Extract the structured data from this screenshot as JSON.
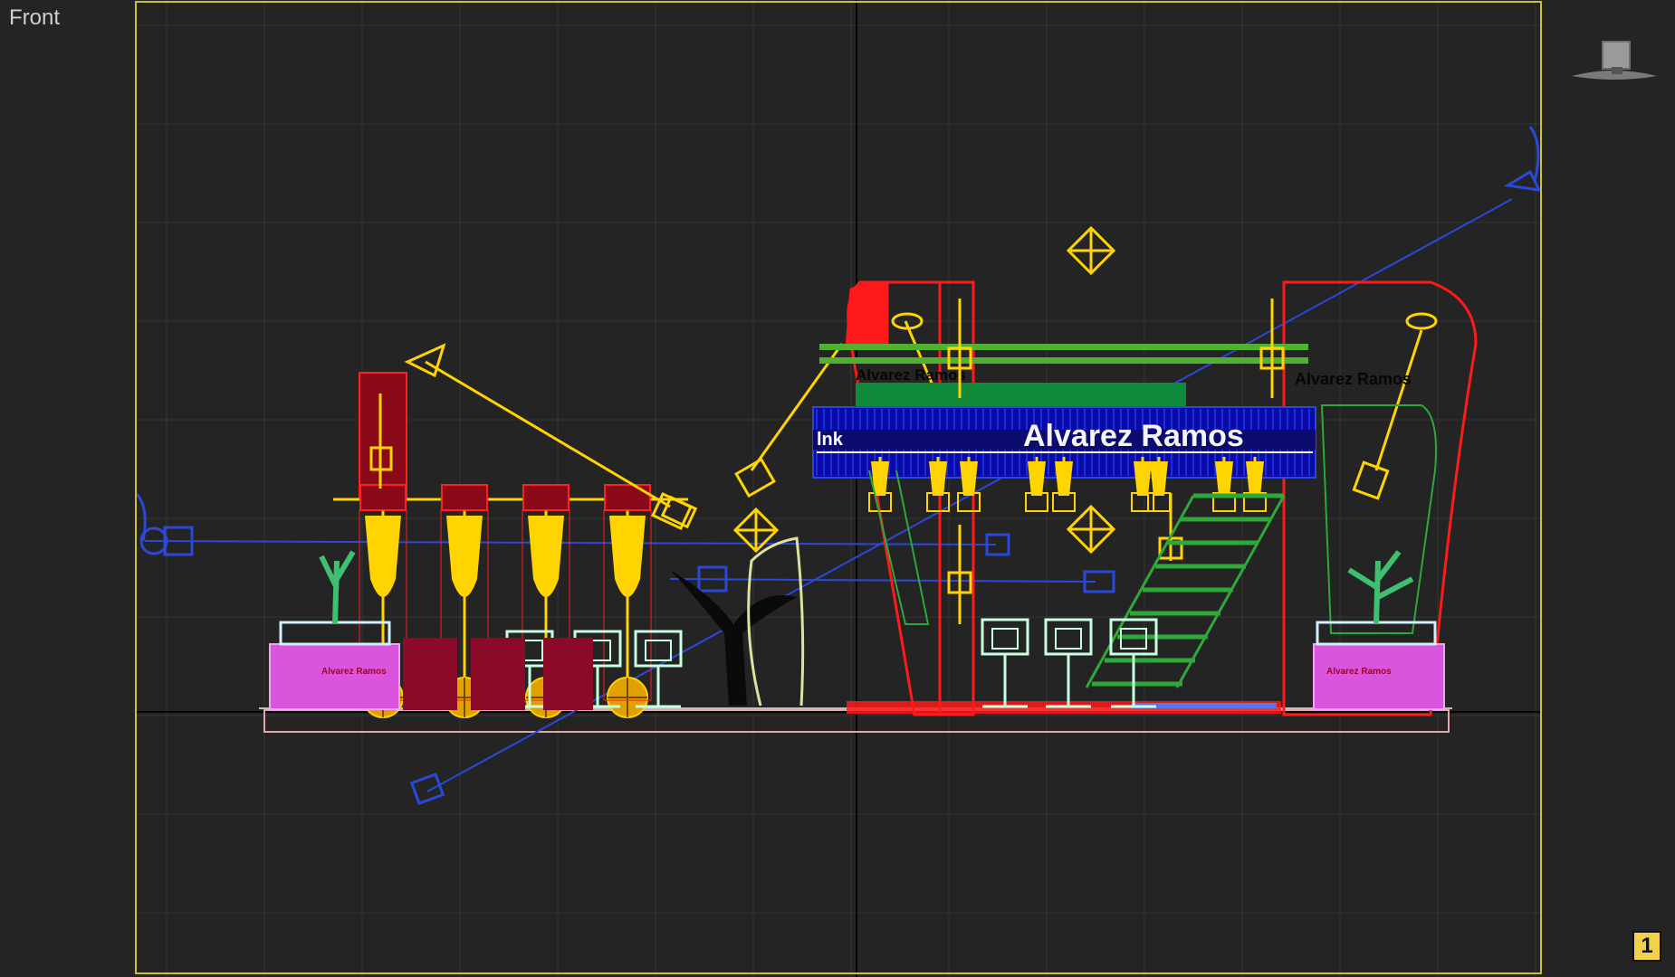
{
  "viewport": {
    "label": "Front",
    "layout_badge": "1",
    "background": "#242424",
    "grid_color": "#3a3a3a",
    "axis_color": "#060606",
    "frame_color": "#c9c13a"
  },
  "scene": {
    "sign_text": "Alvarez Ramos",
    "sign_prefix": "lnk",
    "header_left_text": "Alvarez Ramos",
    "header_right_text": "Alvarez Ramos",
    "planter_left_text": "Alvarez Ramos",
    "planter_right_text": "Alvarez Ramos"
  },
  "icons": {
    "viewcube": "viewcube-icon",
    "light_target": "light-target-icon",
    "camera": "camera-icon"
  }
}
